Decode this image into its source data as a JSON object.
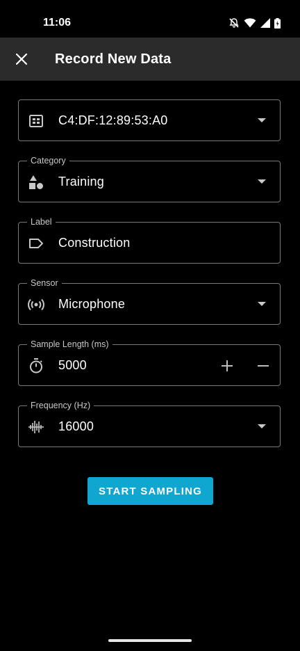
{
  "status_bar": {
    "time": "11:06",
    "icons": [
      "notifications-off-icon",
      "wifi-icon",
      "signal-icon",
      "battery-icon"
    ]
  },
  "app_bar": {
    "title": "Record New Data",
    "close_icon": "close-icon"
  },
  "form": {
    "device": {
      "value": "C4:DF:12:89:53:A0",
      "icon": "device-chip-icon"
    },
    "category": {
      "legend": "Category",
      "value": "Training",
      "icon": "shapes-icon"
    },
    "label": {
      "legend": "Label",
      "value": "Construction",
      "icon": "label-tag-icon"
    },
    "sensor": {
      "legend": "Sensor",
      "value": "Microphone",
      "icon": "sensor-broadcast-icon"
    },
    "sample_length": {
      "legend": "Sample Length (ms)",
      "value": "5000",
      "icon": "timer-icon"
    },
    "frequency": {
      "legend": "Frequency (Hz)",
      "value": "16000",
      "icon": "waveform-icon"
    }
  },
  "actions": {
    "start_label": "START SAMPLING"
  },
  "colors": {
    "background": "#000000",
    "app_bar": "#2b2b2b",
    "outline": "#7a7a7a",
    "accent": "#0fa7d0"
  }
}
